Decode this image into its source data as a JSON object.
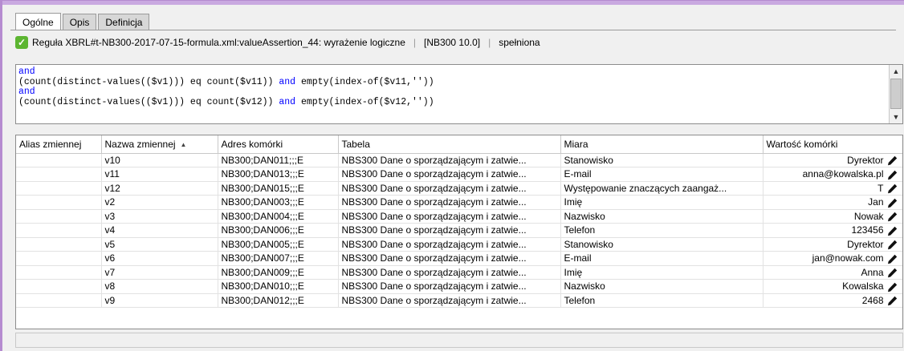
{
  "tabs": [
    {
      "label": "Ogólne",
      "active": true
    },
    {
      "label": "Opis",
      "active": false
    },
    {
      "label": "Definicja",
      "active": false
    }
  ],
  "status": {
    "rule_text": "Reguła XBRL#t-NB300-2017-07-15-formula.xml:valueAssertion_44: wyrażenie logiczne",
    "code_ref": "[NB300 10.0]",
    "result": "spełniona",
    "icon": "check-icon",
    "icon_color": "#5cb531"
  },
  "expression": {
    "lines": [
      {
        "kw": "and",
        "text": ""
      },
      {
        "prefix": "(count(distinct-values(($v1))) eq count($v11)) ",
        "kw": "and",
        "text": " empty(index-of($v11,''))"
      },
      {
        "kw": "and",
        "text": ""
      },
      {
        "prefix": "(count(distinct-values(($v1))) eq count($v12)) ",
        "kw": "and",
        "text": " empty(index-of($v12,''))"
      }
    ],
    "keyword_color": "#0000ff"
  },
  "grid": {
    "columns": [
      "Alias zmiennej",
      "Nazwa zmiennej",
      "Adres komórki",
      "Tabela",
      "Miara",
      "Wartość komórki"
    ],
    "sorted_column": "Nazwa zmiennej",
    "rows": [
      {
        "alias": "",
        "name": "v10",
        "address": "NB300;DAN011;;;E",
        "table": "NBS300 Dane o sporządzającym i zatwie...",
        "measure": "Stanowisko",
        "value": "Dyrektor"
      },
      {
        "alias": "",
        "name": "v11",
        "address": "NB300;DAN013;;;E",
        "table": "NBS300 Dane o sporządzającym i zatwie...",
        "measure": "E-mail",
        "value": "anna@kowalska.pl"
      },
      {
        "alias": "",
        "name": "v12",
        "address": "NB300;DAN015;;;E",
        "table": "NBS300 Dane o sporządzającym i zatwie...",
        "measure": "Występowanie znaczących zaangaż...",
        "value": "T"
      },
      {
        "alias": "",
        "name": "v2",
        "address": "NB300;DAN003;;;E",
        "table": "NBS300 Dane o sporządzającym i zatwie...",
        "measure": "Imię",
        "value": "Jan"
      },
      {
        "alias": "",
        "name": "v3",
        "address": "NB300;DAN004;;;E",
        "table": "NBS300 Dane o sporządzającym i zatwie...",
        "measure": "Nazwisko",
        "value": "Nowak"
      },
      {
        "alias": "",
        "name": "v4",
        "address": "NB300;DAN006;;;E",
        "table": "NBS300 Dane o sporządzającym i zatwie...",
        "measure": "Telefon",
        "value": "123456"
      },
      {
        "alias": "",
        "name": "v5",
        "address": "NB300;DAN005;;;E",
        "table": "NBS300 Dane o sporządzającym i zatwie...",
        "measure": "Stanowisko",
        "value": "Dyrektor"
      },
      {
        "alias": "",
        "name": "v6",
        "address": "NB300;DAN007;;;E",
        "table": "NBS300 Dane o sporządzającym i zatwie...",
        "measure": "E-mail",
        "value": "jan@nowak.com"
      },
      {
        "alias": "",
        "name": "v7",
        "address": "NB300;DAN009;;;E",
        "table": "NBS300 Dane o sporządzającym i zatwie...",
        "measure": "Imię",
        "value": "Anna"
      },
      {
        "alias": "",
        "name": "v8",
        "address": "NB300;DAN010;;;E",
        "table": "NBS300 Dane o sporządzającym i zatwie...",
        "measure": "Nazwisko",
        "value": "Kowalska"
      },
      {
        "alias": "",
        "name": "v9",
        "address": "NB300;DAN012;;;E",
        "table": "NBS300 Dane o sporządzającym i zatwie...",
        "measure": "Telefon",
        "value": "2468"
      }
    ],
    "value_icon": "pencil-icon"
  }
}
